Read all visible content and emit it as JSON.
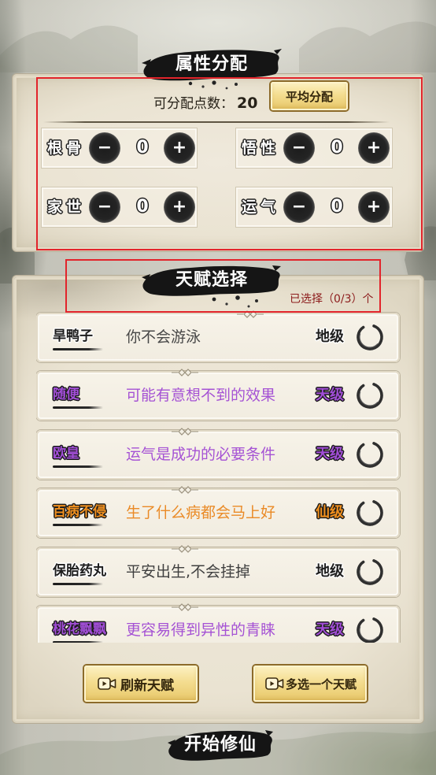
{
  "attributes_panel": {
    "title": "属性分配",
    "points_label": "可分配点数：",
    "points_value": "20",
    "distribute_button": "平均分配",
    "minus_symbol": "−",
    "plus_symbol": "+",
    "attributes": [
      {
        "label": "根骨",
        "value": "0"
      },
      {
        "label": "悟性",
        "value": "0"
      },
      {
        "label": "家世",
        "value": "0"
      },
      {
        "label": "运气",
        "value": "0"
      }
    ]
  },
  "talents_panel": {
    "title": "天赋选择",
    "selected_text": "已选择（0/3）个",
    "talents": [
      {
        "name": "旱鸭子",
        "description": "你不会游泳",
        "grade": "地级",
        "color": "#1c1c1c",
        "outline": "#ffffff",
        "description_color": "#474747"
      },
      {
        "name": "随便",
        "description": "可能有意想不到的效果",
        "grade": "天级",
        "color": "#a14ed6",
        "outline": "#1a1a1a",
        "description_color": "#a552d4"
      },
      {
        "name": "欧皇",
        "description": "运气是成功的必要条件",
        "grade": "天级",
        "color": "#a14ed6",
        "outline": "#1a1a1a",
        "description_color": "#a552d4"
      },
      {
        "name": "百病不侵",
        "description": "生了什么病都会马上好",
        "grade": "仙级",
        "color": "#f0901f",
        "outline": "#1a1a1a",
        "description_color": "#ea8a26"
      },
      {
        "name": "保胎药丸",
        "description": "平安出生,不会挂掉",
        "grade": "地级",
        "color": "#1c1c1c",
        "outline": "#ffffff",
        "description_color": "#3f3f3f"
      },
      {
        "name": "桃花飘飘",
        "description": "更容易得到异性的青睐",
        "grade": "天级",
        "color": "#a14ed6",
        "outline": "#1a1a1a",
        "description_color": "#a552d4"
      }
    ],
    "refresh_button": "刷新天赋",
    "extra_choice_button": "多选一个天赋"
  },
  "start_button": "开始修仙",
  "icons": {
    "select": "ring-icon",
    "ad_video": "video-icon",
    "card_ornament": "diamond-ornament-icon",
    "title_banner": "ink-brush-stroke"
  },
  "colors": {
    "highlight_box": "#e2242b",
    "selected_text": "#8c1b1b"
  }
}
